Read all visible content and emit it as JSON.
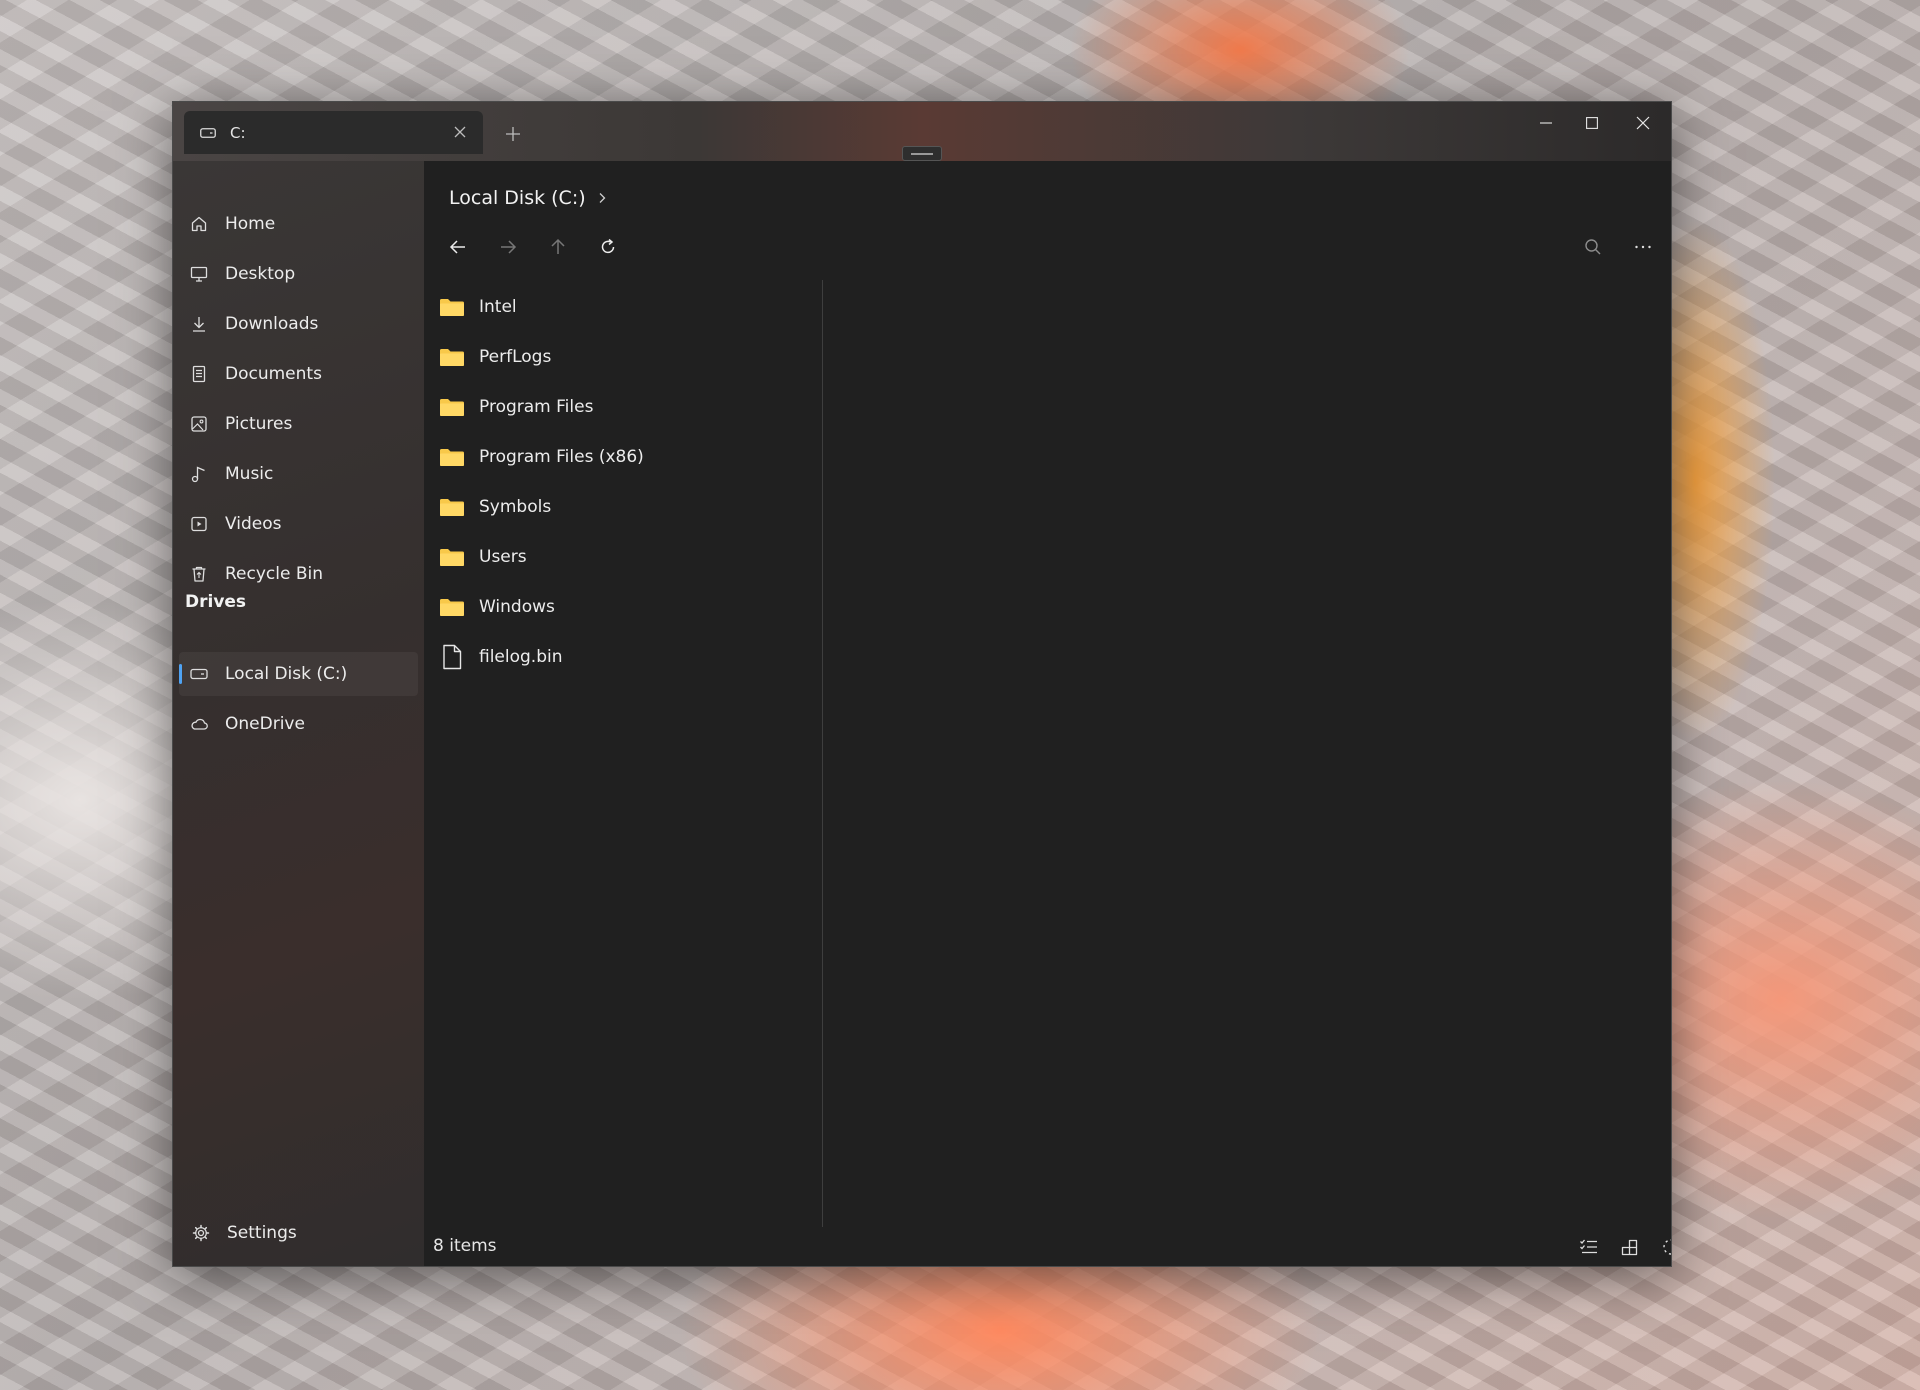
{
  "window": {
    "tab": {
      "title": "C:",
      "icon": "drive-icon"
    },
    "controls": [
      "minimize-icon",
      "maximize-icon",
      "close-icon"
    ]
  },
  "sidebar": {
    "items": [
      {
        "label": "Home",
        "icon": "home-icon"
      },
      {
        "label": "Desktop",
        "icon": "desktop-icon"
      },
      {
        "label": "Downloads",
        "icon": "download-icon"
      },
      {
        "label": "Documents",
        "icon": "document-icon"
      },
      {
        "label": "Pictures",
        "icon": "picture-icon"
      },
      {
        "label": "Music",
        "icon": "music-icon"
      },
      {
        "label": "Videos",
        "icon": "video-icon"
      },
      {
        "label": "Recycle Bin",
        "icon": "recycle-bin-icon"
      }
    ],
    "drives_heading": "Drives",
    "drives": [
      {
        "label": "Local Disk (C:)",
        "icon": "drive-icon",
        "selected": true
      },
      {
        "label": "OneDrive",
        "icon": "cloud-icon",
        "selected": false
      }
    ],
    "settings_label": "Settings"
  },
  "content": {
    "breadcrumb": "Local Disk (C:)",
    "files": [
      {
        "name": "Intel",
        "type": "folder"
      },
      {
        "name": "PerfLogs",
        "type": "folder"
      },
      {
        "name": "Program Files",
        "type": "folder"
      },
      {
        "name": "Program Files (x86)",
        "type": "folder"
      },
      {
        "name": "Symbols",
        "type": "folder"
      },
      {
        "name": "Users",
        "type": "folder"
      },
      {
        "name": "Windows",
        "type": "folder"
      },
      {
        "name": "filelog.bin",
        "type": "file"
      }
    ],
    "status": "8 items"
  },
  "colors": {
    "accent": "#4fa3f3",
    "folder": "#f8c94a",
    "background": "#202020"
  }
}
